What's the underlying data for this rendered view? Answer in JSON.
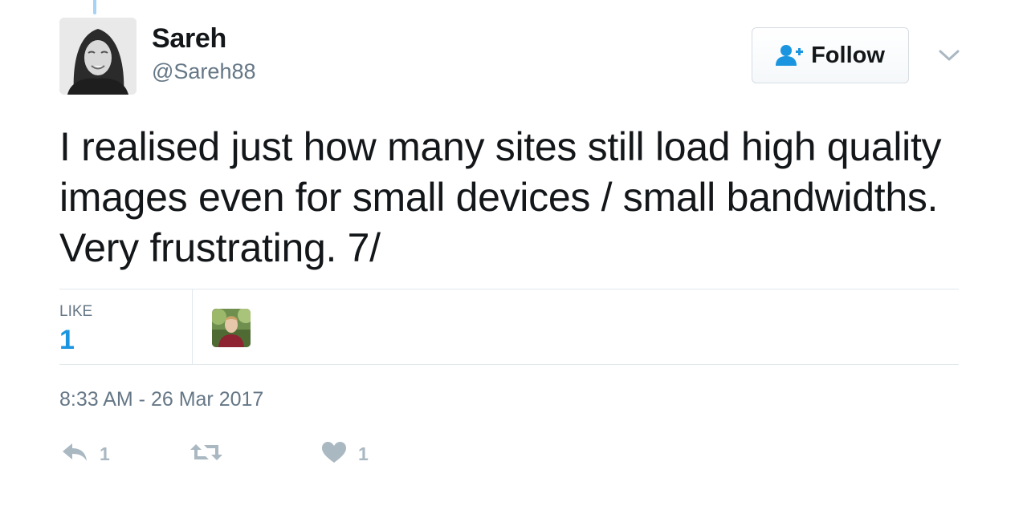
{
  "author": {
    "name": "Sareh",
    "handle": "@Sareh88"
  },
  "follow_button": {
    "label": "Follow",
    "icon": "add-user-icon"
  },
  "menu": {
    "icon": "chevron-down-icon"
  },
  "tweet": {
    "text": "I realised just how many sites still load high quality images even for small devices / small bandwidths. Very frustrating. 7/"
  },
  "stats": {
    "likes_label": "LIKE",
    "likes_count": "1"
  },
  "timestamp": "8:33 AM - 26 Mar 2017",
  "actions": {
    "reply": {
      "icon": "reply-icon",
      "count": "1"
    },
    "retweet": {
      "icon": "retweet-icon",
      "count": ""
    },
    "like": {
      "icon": "heart-icon",
      "count": "1"
    }
  },
  "colors": {
    "accent": "#1b95e0",
    "text": "#14171a",
    "secondary_text": "#657786",
    "action_gray": "#aab8c2",
    "divider": "#e1e8ed"
  }
}
